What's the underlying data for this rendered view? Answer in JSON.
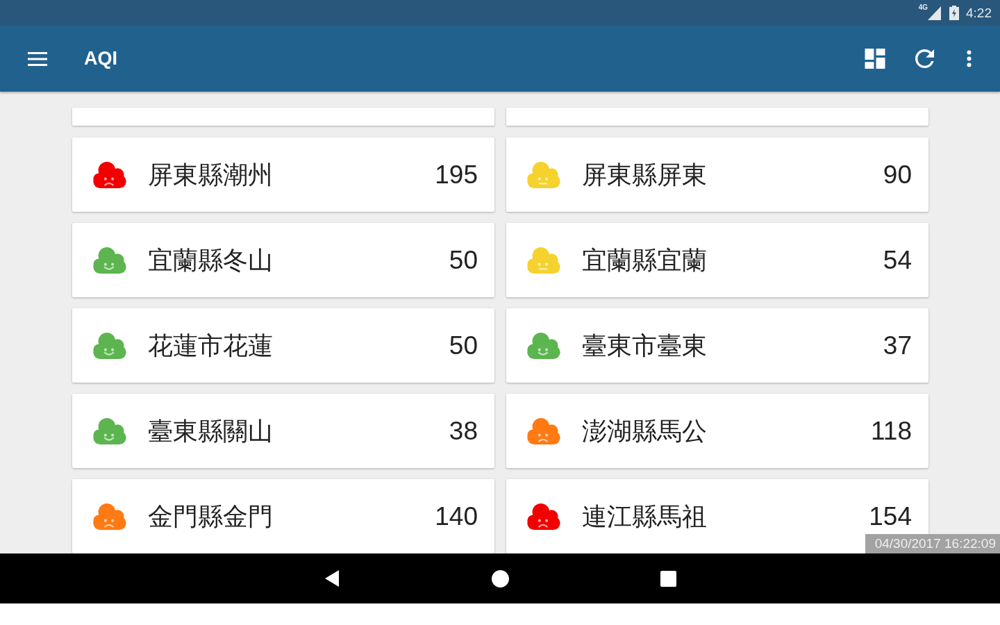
{
  "status_bar": {
    "network": "4G",
    "time": "4:22"
  },
  "app_bar": {
    "title": "AQI"
  },
  "stations": [
    {
      "name": "屏東縣潮州",
      "aqi": "195",
      "color": "#f20000",
      "kind": "frown"
    },
    {
      "name": "屏東縣屏東",
      "aqi": "90",
      "color": "#f5d22e",
      "kind": "neutral"
    },
    {
      "name": "宜蘭縣冬山",
      "aqi": "50",
      "color": "#5cb54f",
      "kind": "smile"
    },
    {
      "name": "宜蘭縣宜蘭",
      "aqi": "54",
      "color": "#f5d22e",
      "kind": "neutral"
    },
    {
      "name": "花蓮市花蓮",
      "aqi": "50",
      "color": "#5cb54f",
      "kind": "smile"
    },
    {
      "name": "臺東市臺東",
      "aqi": "37",
      "color": "#5cb54f",
      "kind": "smile"
    },
    {
      "name": "臺東縣關山",
      "aqi": "38",
      "color": "#5cb54f",
      "kind": "smile"
    },
    {
      "name": "澎湖縣馬公",
      "aqi": "118",
      "color": "#ff7a12",
      "kind": "frown"
    },
    {
      "name": "金門縣金門",
      "aqi": "140",
      "color": "#ff7a12",
      "kind": "frown"
    },
    {
      "name": "連江縣馬祖",
      "aqi": "154",
      "color": "#f20000",
      "kind": "frown"
    }
  ],
  "updated": "04/30/2017 16:22:09"
}
